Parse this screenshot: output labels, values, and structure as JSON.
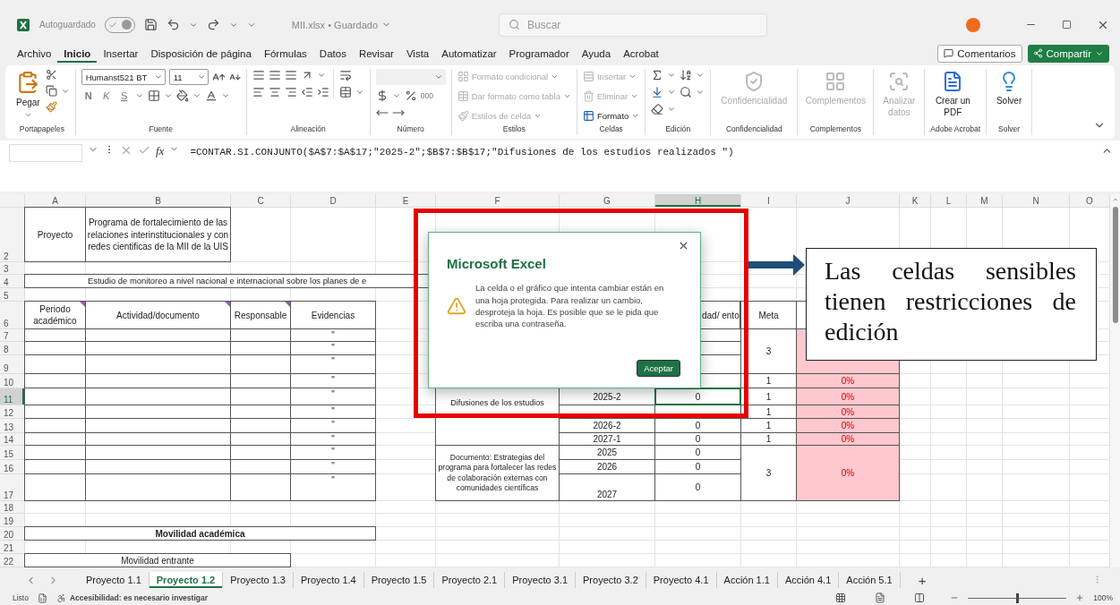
{
  "title_bar": {
    "autosave_label": "Autoguardado",
    "autosave_on": true,
    "file": "MII.xlsx • Guardado",
    "search_placeholder": "Buscar"
  },
  "menu": [
    {
      "label": "Archivo",
      "selected": false
    },
    {
      "label": "Inicio",
      "selected": true
    },
    {
      "label": "Insertar",
      "selected": false
    },
    {
      "label": "Disposición de página",
      "selected": false
    },
    {
      "label": "Fórmulas",
      "selected": false
    },
    {
      "label": "Datos",
      "selected": false
    },
    {
      "label": "Revisar",
      "selected": false
    },
    {
      "label": "Vista",
      "selected": false
    },
    {
      "label": "Automatizar",
      "selected": false
    },
    {
      "label": "Programador",
      "selected": false
    },
    {
      "label": "Ayuda",
      "selected": false
    },
    {
      "label": "Acrobat",
      "selected": false
    }
  ],
  "comments_button": "Comentarios",
  "share_button": "Compartir",
  "ribbon": {
    "groups": [
      {
        "kind": "clipboard",
        "label": "Portapapeles",
        "items": [
          {
            "label": "Pegar",
            "disabled": false
          }
        ]
      },
      {
        "kind": "font",
        "label": "Fuente",
        "font": "Humanst521 BT",
        "size": "11",
        "styles": [
          "N",
          "K",
          "S"
        ]
      },
      {
        "kind": "alignment",
        "label": "Alineación"
      },
      {
        "kind": "number",
        "label": "Número",
        "thousands": "000"
      },
      {
        "kind": "styles",
        "label": "Estilos",
        "items": [
          {
            "label": "Formato condicional",
            "disabled": true
          },
          {
            "label": "Dar formato como tabla",
            "disabled": true
          },
          {
            "label": "Estilos de celda",
            "disabled": true
          }
        ]
      },
      {
        "kind": "cells",
        "label": "Celdas",
        "items": [
          {
            "label": "Insertar",
            "disabled": true
          },
          {
            "label": "Eliminar",
            "disabled": true
          },
          {
            "label": "Formato",
            "disabled": false
          }
        ]
      },
      {
        "kind": "editing",
        "label": "Edición"
      },
      {
        "kind": "sensitivity",
        "label": "Confidencialidad",
        "items": [
          {
            "label": "Confidencialidad",
            "disabled": true
          }
        ]
      },
      {
        "kind": "addins",
        "label": "Complementos",
        "items": [
          {
            "label": "Complementos",
            "disabled": true
          }
        ]
      },
      {
        "kind": "analyze",
        "items": [
          {
            "label": "Analizar datos",
            "disabled": true
          }
        ]
      },
      {
        "kind": "pdf",
        "label": "Adobe Acrobat",
        "items": [
          {
            "label": "Crear un PDF",
            "disabled": false
          }
        ]
      },
      {
        "kind": "solver",
        "label": "Solver",
        "items": [
          {
            "label": "Solver",
            "disabled": false
          }
        ]
      }
    ]
  },
  "formula_bar": {
    "fx": "fx",
    "formula": "=CONTAR.SI.CONJUNTO($A$7:$A$17;\"2025-2\";$B$7:$B$17;\"Difusiones de los estudios realizados \")"
  },
  "sheet": {
    "columns": [
      {
        "label": "A",
        "selected": false
      },
      {
        "label": "B",
        "selected": false
      },
      {
        "label": "C",
        "selected": false
      },
      {
        "label": "D",
        "selected": false
      },
      {
        "label": "E",
        "selected": false
      },
      {
        "label": "F",
        "selected": false
      },
      {
        "label": "G",
        "selected": false
      },
      {
        "label": "H",
        "selected": true
      },
      {
        "label": "I",
        "selected": false
      },
      {
        "label": "J",
        "selected": false
      },
      {
        "label": "K",
        "selected": false
      },
      {
        "label": "L",
        "selected": false
      },
      {
        "label": "M",
        "selected": false
      },
      {
        "label": "N",
        "selected": false
      },
      {
        "label": "O",
        "selected": false
      }
    ],
    "rows": [
      {
        "label": "2",
        "selected": false
      },
      {
        "label": "3",
        "selected": false
      },
      {
        "label": "4",
        "selected": false
      },
      {
        "label": "5",
        "selected": false
      },
      {
        "label": "6",
        "selected": false
      },
      {
        "label": "7",
        "selected": false
      },
      {
        "label": "8",
        "selected": false
      },
      {
        "label": "9",
        "selected": false
      },
      {
        "label": "10",
        "selected": false
      },
      {
        "label": "11",
        "selected": true
      },
      {
        "label": "12",
        "selected": false
      },
      {
        "label": "13",
        "selected": false
      },
      {
        "label": "14",
        "selected": false
      },
      {
        "label": "15",
        "selected": false
      },
      {
        "label": "16",
        "selected": false
      },
      {
        "label": "17",
        "selected": false
      },
      {
        "label": "18",
        "selected": false
      },
      {
        "label": "19",
        "selected": false
      },
      {
        "label": "20",
        "selected": false
      },
      {
        "label": "21",
        "selected": false
      },
      {
        "label": "22",
        "selected": false
      }
    ],
    "cells": [
      {
        "text": "Proyecto",
        "alert": false
      },
      {
        "text": "Programa de fortalecimiento de las relaciones interinstitucionales y con redes cientificas de la MII de la UIS",
        "alert": false
      },
      {
        "text": "Estudio de monitoreo a nivel nacional e internacional sobre los planes de e",
        "alert": false
      },
      {
        "text": "Periodo académico",
        "comment": true,
        "alert": false
      },
      {
        "text": "Actividad/documento",
        "comment": true,
        "alert": false
      },
      {
        "text": "Responsable",
        "comment": true,
        "alert": false
      },
      {
        "text": "Evidencias",
        "alert": false
      },
      {
        "text": "\"",
        "comment": false,
        "alert": false
      },
      {
        "text": "\"",
        "comment": false,
        "alert": false
      },
      {
        "text": "\"",
        "comment": false,
        "alert": false
      },
      {
        "text": "\"",
        "comment": false,
        "alert": false
      },
      {
        "text": "\"",
        "comment": false,
        "alert": false
      },
      {
        "text": "\"",
        "comment": false,
        "alert": false
      },
      {
        "text": "\"",
        "comment": false,
        "alert": false
      },
      {
        "text": "\"",
        "comment": false,
        "alert": false
      },
      {
        "text": "\"",
        "comment": false,
        "alert": false
      },
      {
        "text": "\"",
        "comment": false,
        "alert": false
      },
      {
        "text": "\"",
        "comment": false,
        "alert": false
      },
      {
        "text": "dad/ ento",
        "comment": false,
        "alert": false
      },
      {
        "text": "Meta",
        "comment": false,
        "alert": false
      },
      {
        "text": "3",
        "comment": false,
        "alert": false
      },
      {
        "comment": false,
        "alert": true
      },
      {
        "text": "1",
        "comment": false,
        "alert": false
      },
      {
        "text": "0%",
        "comment": false,
        "alert": true
      },
      {
        "text": "Difusiones de los estudios",
        "comment": false,
        "alert": false
      },
      {
        "text": "2025-2",
        "comment": false,
        "alert": false
      },
      {
        "text": "0",
        "comment": false,
        "alert": false
      },
      {
        "text": "1",
        "comment": false,
        "alert": false
      },
      {
        "text": "0%",
        "comment": false,
        "alert": true
      },
      {
        "text": "1",
        "comment": false,
        "alert": false
      },
      {
        "text": "0%",
        "comment": false,
        "alert": true
      },
      {
        "text": "2026-2",
        "comment": false,
        "alert": false
      },
      {
        "text": "0",
        "comment": false,
        "alert": false
      },
      {
        "text": "1",
        "comment": false,
        "alert": false
      },
      {
        "text": "0%",
        "comment": false,
        "alert": true
      },
      {
        "text": "2027-1",
        "comment": false,
        "alert": false
      },
      {
        "text": "0",
        "comment": false,
        "alert": false
      },
      {
        "text": "1",
        "comment": false,
        "alert": false
      },
      {
        "text": "0%",
        "comment": false,
        "alert": true
      },
      {
        "text": "Documento: Estrategias del programa para fortalecer las redes de colaboración externas con comunidades científicas",
        "comment": false,
        "alert": false
      },
      {
        "text": "2025",
        "comment": false,
        "alert": false
      },
      {
        "text": "2026",
        "comment": false,
        "alert": false
      },
      {
        "text": "2027",
        "comment": false,
        "alert": false
      },
      {
        "text": "0",
        "comment": false,
        "alert": false
      },
      {
        "text": "0",
        "comment": false,
        "alert": false
      },
      {
        "text": "0",
        "comment": false,
        "alert": false
      },
      {
        "text": "3",
        "comment": false,
        "alert": false
      },
      {
        "text": "0%",
        "comment": false,
        "alert": true
      },
      {
        "text": "Movilidad académica",
        "comment": false,
        "alert": false
      },
      {
        "text": "Movilidad entrante",
        "comment": false,
        "alert": false
      }
    ]
  },
  "dialog": {
    "title": "Microsoft Excel",
    "message": "La celda o el gráfico que intenta cambiar están en una hoja protegida. Para realizar un cambio, desproteja la hoja. Es posible que se le pida que escriba una contraseña.",
    "button": "Aceptar"
  },
  "callout": "Las celdas sensibles tienen restricciones de edición",
  "sheet_tabs": [
    {
      "label": "Proyecto 1.1",
      "selected": false
    },
    {
      "label": "Proyecto 1.2",
      "selected": true
    },
    {
      "label": "Proyecto 1.3",
      "selected": false
    },
    {
      "label": "Proyecto 1.4",
      "selected": false
    },
    {
      "label": "Proyecto 1.5",
      "selected": false
    },
    {
      "label": "Proyecto 2.1",
      "selected": false
    },
    {
      "label": "Proyecto 3.1",
      "selected": false
    },
    {
      "label": "Proyecto 3.2",
      "selected": false
    },
    {
      "label": "Proyecto 4.1",
      "selected": false
    },
    {
      "label": "Acción 1.1",
      "selected": false
    },
    {
      "label": "Acción 4.1",
      "selected": false
    },
    {
      "label": "Acción 5.1",
      "selected": false
    }
  ],
  "add_sheet": "+",
  "status_bar": {
    "ready": "Listo",
    "accessibility": "Accesibilidad: es necesario investigar",
    "zoom": {
      "level": 0.5,
      "label": "100%"
    }
  }
}
